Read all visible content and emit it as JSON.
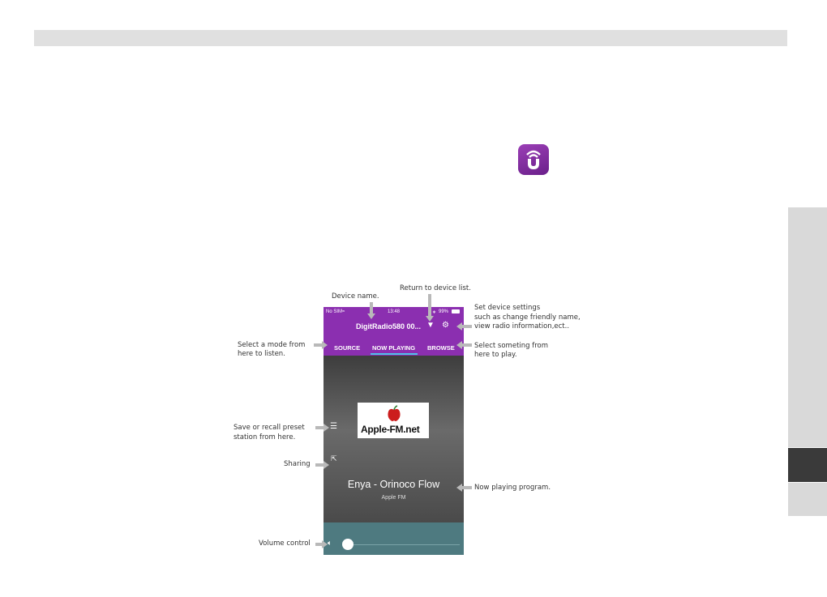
{
  "status": {
    "carrier": "No SIM",
    "time": "13:48",
    "battery": "99%"
  },
  "device": {
    "name": "DigitRadio580 00..."
  },
  "tabs": [
    "SOURCE",
    "NOW PLAYING",
    "BROWSE"
  ],
  "now_playing": {
    "logo_text": "Apple-FM.net",
    "title": "Enya - Orinoco Flow",
    "station": "Apple FM"
  },
  "annotations": {
    "device_name": "Device name.",
    "return_list": "Return to device list.",
    "settings_1": "Set device settings",
    "settings_2": "such as change friendly name,",
    "settings_3": "view radio information,ect..",
    "mode_1": "Select a mode from",
    "mode_2": "here to listen.",
    "browse_1": "Select someting from",
    "browse_2": "here to play.",
    "preset_1": "Save or recall preset",
    "preset_2": "station from here.",
    "sharing": "Sharing",
    "now_playing": "Now playing program.",
    "volume": "Volume control"
  },
  "colors": {
    "accent": "#8b2fb0",
    "tab_underline": "#4fc3e8",
    "volume_bg": "#4e7a80"
  }
}
